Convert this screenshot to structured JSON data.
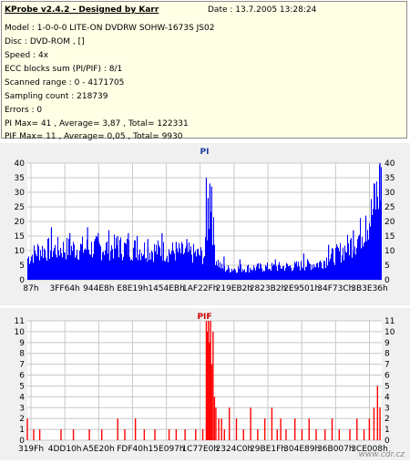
{
  "header": {
    "app": "KProbe v2.4.2 - Designed by Karr",
    "date": "Date : 13.7.2005 13:28:24",
    "lines": [
      "Model : 1-0-0-0 LITE-ON DVDRW SOHW-1673S JS02",
      "Disc : DVD-ROM ,  []",
      "Speed : 4x",
      "ECC blocks sum (PI/PIF) : 8/1",
      "Scanned range : 0 - 4171705",
      "Sampling count : 218739",
      "Errors : 0",
      "PI Max= 41 , Average= 3,87 , Total= 122331",
      "PIF Max= 11 , Average= 0,05 , Total= 9930"
    ]
  },
  "watermark": "www.cdr.cz",
  "colors": {
    "pi": "#0000ff",
    "pif": "#ff0000",
    "pi_title": "#1f3f9f",
    "pif_title": "#cc0000",
    "panel": "#f0f0f0"
  },
  "chart_data": [
    {
      "type": "bar",
      "title": "PI",
      "ylim": [
        0,
        40
      ],
      "yticks": [
        0,
        5,
        10,
        15,
        20,
        25,
        30,
        35,
        40
      ],
      "xtick_labels": [
        "87h",
        "3FF64h",
        "944E8h",
        "E8E19h",
        "1454EBh",
        "1AF22Fh",
        "219EB2h",
        "2823B2h",
        "2E9501h",
        "34F73Ch",
        "3B3E36h"
      ],
      "grid": true,
      "max": 41,
      "profile": [
        {
          "x": 0.0,
          "y": 8
        },
        {
          "x": 0.03,
          "y": 11
        },
        {
          "x": 0.1,
          "y": 11.5
        },
        {
          "x": 0.25,
          "y": 12
        },
        {
          "x": 0.35,
          "y": 11
        },
        {
          "x": 0.45,
          "y": 10
        },
        {
          "x": 0.5,
          "y": 9
        },
        {
          "x": 0.505,
          "y": 18
        },
        {
          "x": 0.51,
          "y": 26
        },
        {
          "x": 0.52,
          "y": 24
        },
        {
          "x": 0.53,
          "y": 8
        },
        {
          "x": 0.55,
          "y": 4
        },
        {
          "x": 0.65,
          "y": 4.5
        },
        {
          "x": 0.75,
          "y": 5
        },
        {
          "x": 0.82,
          "y": 6
        },
        {
          "x": 0.88,
          "y": 10
        },
        {
          "x": 0.93,
          "y": 15
        },
        {
          "x": 0.97,
          "y": 24
        },
        {
          "x": 0.99,
          "y": 33
        },
        {
          "x": 1.0,
          "y": 40
        }
      ],
      "spikes": [
        {
          "x": 0.068,
          "y": 18
        },
        {
          "x": 0.12,
          "y": 16
        },
        {
          "x": 0.17,
          "y": 18
        },
        {
          "x": 0.2,
          "y": 16
        },
        {
          "x": 0.23,
          "y": 17
        },
        {
          "x": 0.255,
          "y": 15
        },
        {
          "x": 0.285,
          "y": 16
        },
        {
          "x": 0.31,
          "y": 15
        },
        {
          "x": 0.34,
          "y": 14
        },
        {
          "x": 0.38,
          "y": 16
        },
        {
          "x": 0.42,
          "y": 13
        },
        {
          "x": 0.45,
          "y": 14
        },
        {
          "x": 0.505,
          "y": 35
        },
        {
          "x": 0.51,
          "y": 28
        },
        {
          "x": 0.515,
          "y": 33
        },
        {
          "x": 0.52,
          "y": 32
        },
        {
          "x": 0.555,
          "y": 8
        },
        {
          "x": 0.6,
          "y": 7
        },
        {
          "x": 0.7,
          "y": 7
        },
        {
          "x": 0.78,
          "y": 9
        },
        {
          "x": 0.85,
          "y": 12
        },
        {
          "x": 0.92,
          "y": 17
        },
        {
          "x": 0.955,
          "y": 22
        },
        {
          "x": 0.98,
          "y": 33
        },
        {
          "x": 0.995,
          "y": 41
        }
      ]
    },
    {
      "type": "bar",
      "title": "PIF",
      "ylim": [
        0,
        11
      ],
      "yticks": [
        0,
        1,
        2,
        3,
        4,
        5,
        6,
        7,
        8,
        9,
        10,
        11
      ],
      "xtick_labels": [
        "319Fh",
        "4DD10h",
        "A5E20h",
        "FDF40h",
        "15E097h",
        "1C77E0h",
        "2324C0h",
        "29BE1Fh",
        "304E89h",
        "36B007h",
        "3CE008h"
      ],
      "grid": true,
      "max": 11,
      "bars": [
        {
          "x": 0.0,
          "y": 2
        },
        {
          "x": 0.018,
          "y": 1
        },
        {
          "x": 0.035,
          "y": 1
        },
        {
          "x": 0.095,
          "y": 1
        },
        {
          "x": 0.13,
          "y": 1
        },
        {
          "x": 0.175,
          "y": 1
        },
        {
          "x": 0.21,
          "y": 1
        },
        {
          "x": 0.255,
          "y": 2
        },
        {
          "x": 0.275,
          "y": 1
        },
        {
          "x": 0.305,
          "y": 2
        },
        {
          "x": 0.33,
          "y": 1
        },
        {
          "x": 0.36,
          "y": 1
        },
        {
          "x": 0.4,
          "y": 1
        },
        {
          "x": 0.42,
          "y": 1
        },
        {
          "x": 0.445,
          "y": 1
        },
        {
          "x": 0.475,
          "y": 1
        },
        {
          "x": 0.495,
          "y": 1
        },
        {
          "x": 0.505,
          "y": 11
        },
        {
          "x": 0.508,
          "y": 10
        },
        {
          "x": 0.511,
          "y": 11
        },
        {
          "x": 0.514,
          "y": 9
        },
        {
          "x": 0.517,
          "y": 11
        },
        {
          "x": 0.52,
          "y": 7
        },
        {
          "x": 0.524,
          "y": 10
        },
        {
          "x": 0.528,
          "y": 4
        },
        {
          "x": 0.532,
          "y": 3
        },
        {
          "x": 0.54,
          "y": 2
        },
        {
          "x": 0.548,
          "y": 2
        },
        {
          "x": 0.556,
          "y": 1
        },
        {
          "x": 0.57,
          "y": 3
        },
        {
          "x": 0.59,
          "y": 2
        },
        {
          "x": 0.61,
          "y": 1
        },
        {
          "x": 0.63,
          "y": 3
        },
        {
          "x": 0.65,
          "y": 1
        },
        {
          "x": 0.67,
          "y": 2
        },
        {
          "x": 0.69,
          "y": 3
        },
        {
          "x": 0.705,
          "y": 1
        },
        {
          "x": 0.715,
          "y": 2
        },
        {
          "x": 0.73,
          "y": 1
        },
        {
          "x": 0.755,
          "y": 2
        },
        {
          "x": 0.775,
          "y": 1
        },
        {
          "x": 0.795,
          "y": 2
        },
        {
          "x": 0.815,
          "y": 1
        },
        {
          "x": 0.84,
          "y": 1
        },
        {
          "x": 0.86,
          "y": 2
        },
        {
          "x": 0.88,
          "y": 1
        },
        {
          "x": 0.91,
          "y": 1
        },
        {
          "x": 0.93,
          "y": 2
        },
        {
          "x": 0.95,
          "y": 1
        },
        {
          "x": 0.965,
          "y": 2
        },
        {
          "x": 0.978,
          "y": 3
        },
        {
          "x": 0.988,
          "y": 5
        },
        {
          "x": 0.995,
          "y": 3
        }
      ]
    }
  ]
}
